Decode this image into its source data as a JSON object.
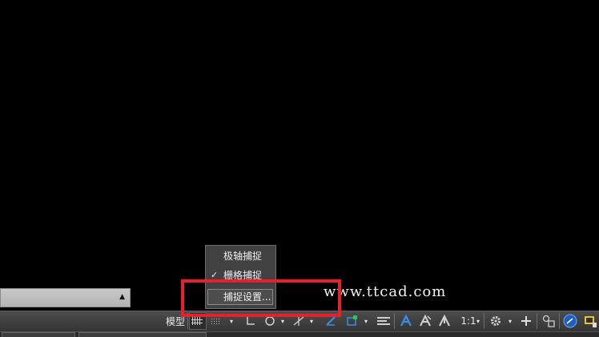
{
  "watermark": "www.ttcad.com",
  "command_line": {
    "arrow_icon": "triangle-up-icon"
  },
  "snap_menu": {
    "items": [
      {
        "label": "极轴捕捉",
        "checked": false
      },
      {
        "label": "栅格捕捉",
        "checked": true,
        "check_mark": "✓"
      }
    ],
    "settings_label": "捕捉设置..."
  },
  "status_bar": {
    "model_label": "模型",
    "scale_label": "1:1",
    "icons": [
      "grid-icon",
      "snap-icon",
      "ortho-icon",
      "polar-icon",
      "osnap-icon",
      "otrack-icon",
      "dynamic-ucs-icon",
      "select-cycle-icon",
      "lineweight-icon",
      "annotation-visibility-icon",
      "auto-scale-icon",
      "annotation-scale-icon",
      "workspace-gear-icon",
      "plus-icon",
      "isolate-objects-icon",
      "hardware-acceleration-icon",
      "clean-screen-icon"
    ]
  },
  "colors": {
    "highlight": "#e8202a",
    "accent_blue": "#3a8ee6"
  }
}
